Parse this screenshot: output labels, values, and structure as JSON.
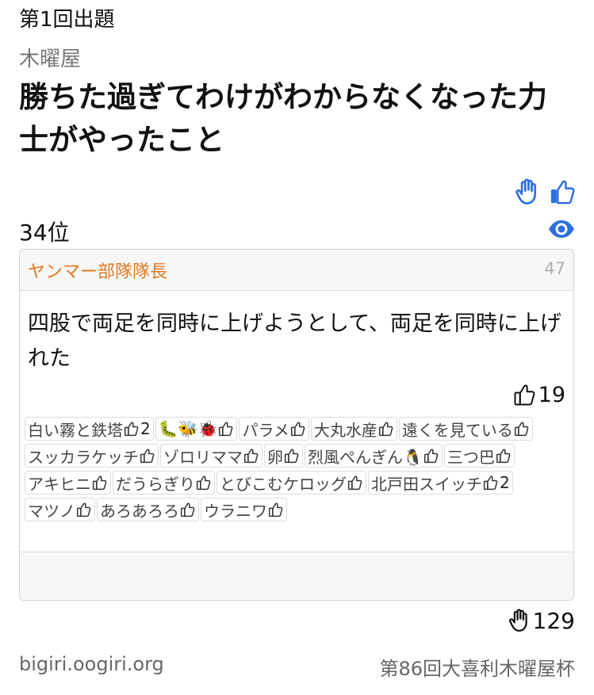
{
  "header": {
    "round": "第1回出題",
    "event": "木曜屋",
    "title": "勝ちた過ぎてわけがわからなくなった力士がやったこと"
  },
  "actions": {
    "hand_icon": "hand-raise-icon",
    "like_icon": "thumbs-up-icon",
    "eye_icon": "eye-icon",
    "accent_color": "#2c6fe0"
  },
  "rank": "34位",
  "card": {
    "author": "ヤンマー部隊隊長",
    "author_color": "#e2781f",
    "answer_number": "47",
    "answer": "四股で両足を同時に上げようとして、両足を同時に上げれた",
    "likes": "19",
    "voters": [
      {
        "name": "白い霧と鉄塔",
        "count": "2"
      },
      {
        "name": "🐛🐝🐞",
        "count": ""
      },
      {
        "name": "パラメ",
        "count": ""
      },
      {
        "name": "大丸水産",
        "count": ""
      },
      {
        "name": "遠くを見ている",
        "count": ""
      },
      {
        "name": "スッカラケッチ",
        "count": ""
      },
      {
        "name": "ゾロリママ",
        "count": ""
      },
      {
        "name": "卵",
        "count": ""
      },
      {
        "name": "烈風ぺんぎん🐧",
        "count": ""
      },
      {
        "name": "三つ巴",
        "count": ""
      },
      {
        "name": "アキヒニ",
        "count": ""
      },
      {
        "name": "だうらぎり",
        "count": ""
      },
      {
        "name": "とびこむケロッグ",
        "count": ""
      },
      {
        "name": "北戸田スイッチ",
        "count": "2"
      },
      {
        "name": "マツノ",
        "count": ""
      },
      {
        "name": "あろあろろ",
        "count": ""
      },
      {
        "name": "ウラニワ",
        "count": ""
      }
    ]
  },
  "total_hands": "129",
  "footer": {
    "site": "bigiri.oogiri.org",
    "cup": "第86回大喜利木曜屋杯"
  }
}
